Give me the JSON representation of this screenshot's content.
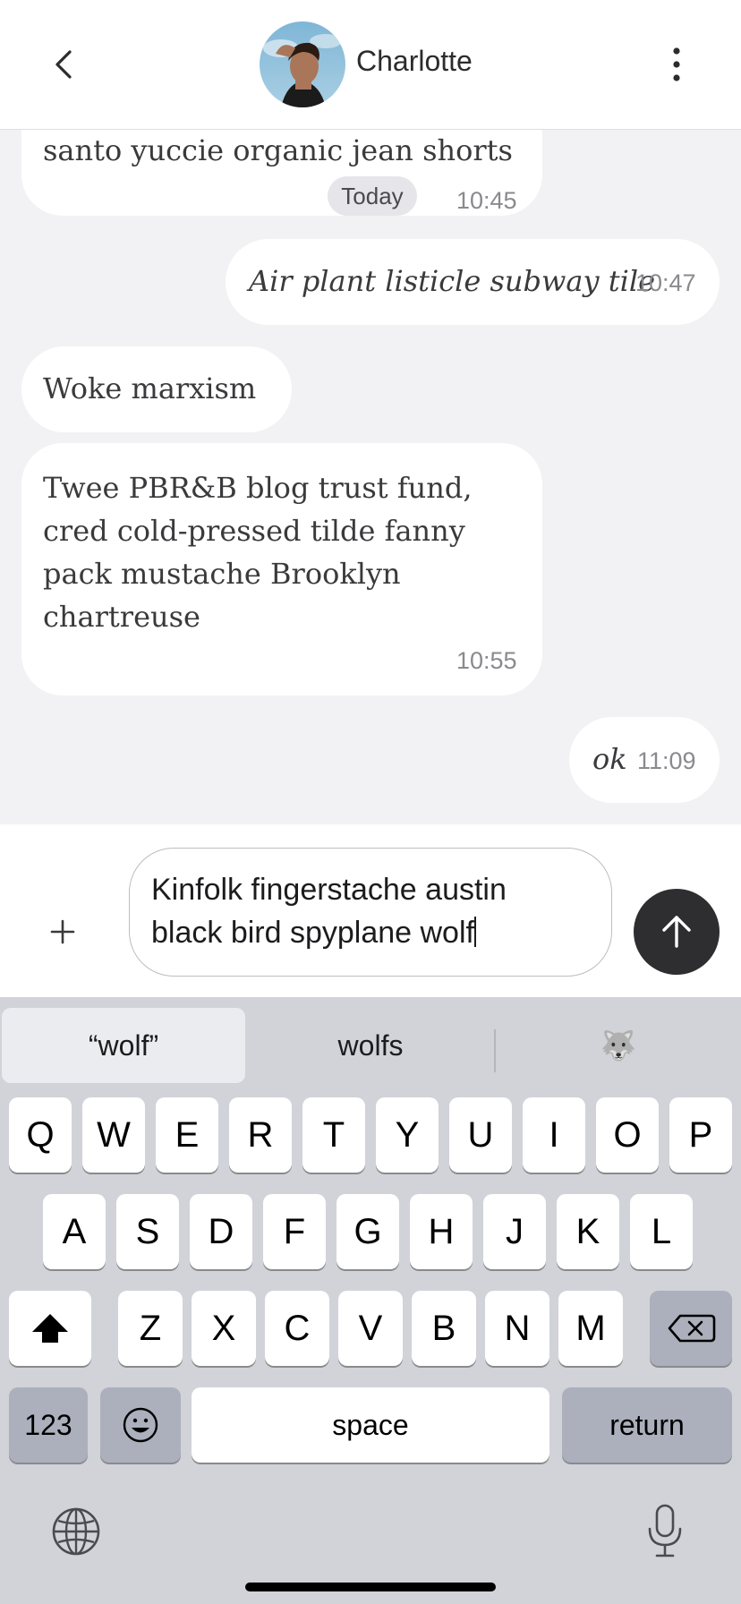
{
  "header": {
    "title": "Charlotte",
    "back_icon": "chevron-left-icon",
    "more_icon": "more-vertical-icon"
  },
  "messages": [
    {
      "text": "santo yuccie organic jean shorts",
      "date_pill": "Today",
      "time": "10:45",
      "side": "incoming"
    },
    {
      "text": "Air plant listicle subway tile",
      "time": "10:47",
      "side": "outgoing"
    },
    {
      "text": "Woke marxism",
      "side": "incoming"
    },
    {
      "text": "Twee PBR&B blog trust fund, cred cold-pressed tilde fanny pack mustache Brooklyn chartreuse",
      "time": "10:55",
      "side": "incoming"
    },
    {
      "text": "ok",
      "time": "11:09",
      "side": "outgoing"
    }
  ],
  "composer": {
    "line1": "Kinfolk fingerstache austin",
    "line2": "black bird spyplane wolf",
    "plus_icon": "plus-icon",
    "send_icon": "arrow-up-icon"
  },
  "keyboard": {
    "suggestions": [
      "“wolf”",
      "wolfs",
      "🐺"
    ],
    "row1": [
      "Q",
      "W",
      "E",
      "R",
      "T",
      "Y",
      "U",
      "I",
      "O",
      "P"
    ],
    "row2": [
      "A",
      "S",
      "D",
      "F",
      "G",
      "H",
      "J",
      "K",
      "L"
    ],
    "row3": [
      "Z",
      "X",
      "C",
      "V",
      "B",
      "N",
      "M"
    ],
    "numbers_label": "123",
    "space_label": "space",
    "return_label": "return",
    "shift_icon": "shift-icon",
    "delete_icon": "backspace-icon",
    "emoji_icon": "emoji-icon",
    "globe_icon": "globe-icon",
    "mic_icon": "microphone-icon"
  },
  "colors": {
    "chat_background": "#f2f2f4",
    "keyboard_background": "#d1d3d9",
    "send_button": "#2e2e30"
  }
}
